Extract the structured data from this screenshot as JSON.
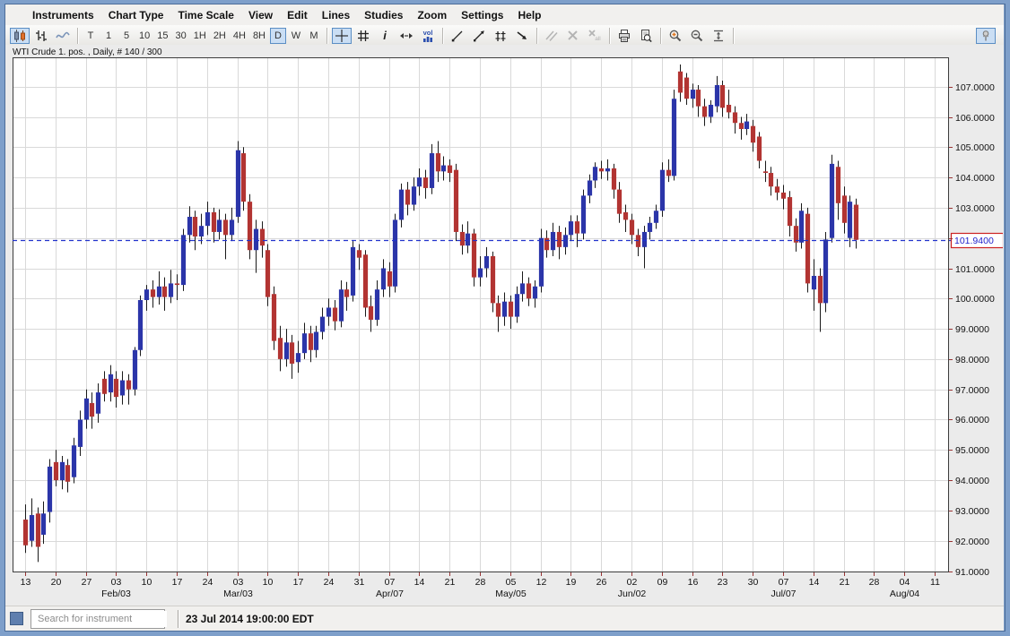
{
  "menubar": {
    "items": [
      "Instruments",
      "Chart Type",
      "Time Scale",
      "View",
      "Edit",
      "Lines",
      "Studies",
      "Zoom",
      "Settings",
      "Help"
    ]
  },
  "toolbar": {
    "groups": [
      {
        "name": "chart-type",
        "buttons": [
          {
            "icon": "candlestick-chart-icon",
            "selected": true
          },
          {
            "icon": "ohlc-bars-icon"
          },
          {
            "icon": "line-chart-icon"
          }
        ]
      },
      {
        "name": "timescale",
        "buttons": [
          {
            "label": "T"
          },
          {
            "label": "1"
          },
          {
            "label": "5"
          },
          {
            "label": "10"
          },
          {
            "label": "15"
          },
          {
            "label": "30"
          },
          {
            "label": "1H"
          },
          {
            "label": "2H"
          },
          {
            "label": "4H"
          },
          {
            "label": "8H"
          },
          {
            "label": "D",
            "selected": true
          },
          {
            "label": "W"
          },
          {
            "label": "M"
          }
        ]
      },
      {
        "name": "cursor-tools",
        "buttons": [
          {
            "icon": "crosshair-icon",
            "selected": true
          },
          {
            "icon": "grid-icon"
          },
          {
            "icon": "info-icon"
          },
          {
            "icon": "expand-horizontal-icon"
          },
          {
            "icon": "volume-icon"
          }
        ]
      },
      {
        "name": "draw-tools",
        "buttons": [
          {
            "icon": "trendline-icon"
          },
          {
            "icon": "ray-icon"
          },
          {
            "icon": "channel-icon"
          },
          {
            "icon": "arrow-icon"
          }
        ]
      },
      {
        "name": "line-edit",
        "buttons": [
          {
            "icon": "parallel-lines-icon",
            "disabled": true
          },
          {
            "icon": "delete-icon",
            "disabled": true
          },
          {
            "icon": "delete-all-icon",
            "disabled": true
          }
        ]
      },
      {
        "name": "print",
        "buttons": [
          {
            "icon": "print-icon"
          },
          {
            "icon": "print-preview-icon"
          }
        ]
      },
      {
        "name": "zoom",
        "buttons": [
          {
            "icon": "zoom-in-icon"
          },
          {
            "icon": "zoom-out-icon"
          },
          {
            "icon": "fit-vertical-icon"
          }
        ]
      }
    ],
    "pin": {
      "icon": "pin-icon"
    },
    "delete_all_sub": "all"
  },
  "chart": {
    "title": "WTI Crude 1. pos. , Daily, # 140 / 300"
  },
  "statusbar": {
    "search_placeholder": "Search for instrument",
    "timestamp": "23 Jul 2014 19:00:00 EDT"
  },
  "chart_data": {
    "type": "candlestick",
    "instrument": "WTI Crude 1. pos.",
    "interval": "Daily",
    "bar_count_label": "# 140 / 300",
    "ylim": [
      91,
      107
    ],
    "y_tick_step": 1.0,
    "y_tick_decimals": 4,
    "grid": true,
    "last_price": 101.94,
    "last_price_label": "101.9400",
    "colors": {
      "up": "#2b35a9",
      "down": "#b23432",
      "wick": "#1a1a1a",
      "grid": "#d9d9d9",
      "last_price_line": "#2233cc",
      "label_border": "#cc2222",
      "label_text": "#2222cc",
      "tick": "#993333"
    },
    "x_labels": [
      {
        "d": "13"
      },
      {
        "d": "20"
      },
      {
        "d": "27"
      },
      {
        "d": "03",
        "m": "Feb/03"
      },
      {
        "d": "10"
      },
      {
        "d": "17"
      },
      {
        "d": "24"
      },
      {
        "d": "03",
        "m": "Mar/03"
      },
      {
        "d": "10"
      },
      {
        "d": "17"
      },
      {
        "d": "24"
      },
      {
        "d": "31"
      },
      {
        "d": "07",
        "m": "Apr/07"
      },
      {
        "d": "14"
      },
      {
        "d": "21"
      },
      {
        "d": "28"
      },
      {
        "d": "05",
        "m": "May/05"
      },
      {
        "d": "12"
      },
      {
        "d": "19"
      },
      {
        "d": "26"
      },
      {
        "d": "02",
        "m": "Jun/02"
      },
      {
        "d": "09"
      },
      {
        "d": "16"
      },
      {
        "d": "23"
      },
      {
        "d": "30"
      },
      {
        "d": "07",
        "m": "Jul/07"
      },
      {
        "d": "14"
      },
      {
        "d": "21"
      },
      {
        "d": "28"
      },
      {
        "d": "04",
        "m": "Aug/04"
      },
      {
        "d": "11"
      }
    ],
    "start_date": "13 Jan 2014",
    "end_date": "23 Jul 2014",
    "candles_ohlc": [
      [
        92.7,
        93.2,
        91.6,
        91.85
      ],
      [
        92.0,
        93.4,
        91.8,
        92.85
      ],
      [
        92.9,
        93.1,
        91.3,
        91.8
      ],
      [
        92.2,
        93.3,
        91.9,
        92.9
      ],
      [
        92.95,
        94.7,
        92.6,
        94.45
      ],
      [
        94.6,
        95.0,
        93.8,
        94.0
      ],
      [
        94.0,
        94.8,
        93.7,
        94.6
      ],
      [
        94.5,
        94.7,
        93.6,
        93.95
      ],
      [
        94.1,
        95.4,
        93.9,
        95.15
      ],
      [
        95.1,
        96.3,
        94.8,
        96.0
      ],
      [
        96.0,
        97.0,
        95.7,
        96.7
      ],
      [
        96.55,
        96.9,
        95.7,
        96.1
      ],
      [
        96.2,
        97.2,
        95.9,
        96.9
      ],
      [
        97.35,
        97.6,
        96.6,
        96.85
      ],
      [
        96.9,
        97.8,
        96.6,
        97.5
      ],
      [
        97.35,
        97.6,
        96.4,
        96.75
      ],
      [
        96.8,
        97.6,
        96.5,
        97.3
      ],
      [
        97.3,
        97.5,
        96.5,
        97.0
      ],
      [
        97.0,
        98.4,
        96.8,
        98.3
      ],
      [
        98.3,
        100.1,
        98.1,
        99.95
      ],
      [
        99.95,
        100.45,
        99.6,
        100.3
      ],
      [
        100.3,
        100.6,
        99.7,
        100.05
      ],
      [
        100.05,
        100.9,
        99.8,
        100.4
      ],
      [
        100.4,
        100.7,
        99.6,
        100.05
      ],
      [
        100.05,
        100.95,
        99.85,
        100.5
      ],
      [
        100.5,
        100.8,
        99.95,
        100.45
      ],
      [
        100.45,
        102.3,
        100.25,
        102.1
      ],
      [
        102.1,
        103.05,
        101.85,
        102.7
      ],
      [
        102.7,
        102.9,
        101.6,
        102.05
      ],
      [
        102.05,
        102.8,
        101.8,
        102.4
      ],
      [
        102.4,
        103.2,
        102.1,
        102.85
      ],
      [
        102.85,
        103.0,
        101.85,
        102.2
      ],
      [
        102.2,
        102.95,
        101.95,
        102.6
      ],
      [
        102.6,
        102.8,
        101.3,
        102.1
      ],
      [
        102.1,
        103.0,
        101.9,
        102.6
      ],
      [
        102.7,
        105.2,
        102.5,
        104.9
      ],
      [
        104.8,
        105.0,
        102.9,
        103.2
      ],
      [
        103.2,
        103.45,
        101.3,
        101.6
      ],
      [
        101.6,
        102.6,
        100.85,
        102.3
      ],
      [
        102.3,
        102.55,
        101.35,
        101.75
      ],
      [
        101.6,
        101.8,
        99.75,
        100.05
      ],
      [
        100.15,
        100.4,
        98.3,
        98.6
      ],
      [
        98.7,
        99.1,
        97.6,
        98.0
      ],
      [
        98.0,
        99.0,
        97.75,
        98.55
      ],
      [
        98.55,
        98.8,
        97.35,
        97.85
      ],
      [
        97.9,
        98.6,
        97.55,
        98.2
      ],
      [
        98.2,
        99.2,
        98.0,
        98.85
      ],
      [
        98.85,
        99.1,
        97.9,
        98.3
      ],
      [
        98.3,
        99.1,
        98.05,
        98.9
      ],
      [
        98.9,
        99.7,
        98.65,
        99.4
      ],
      [
        99.4,
        100.0,
        99.1,
        99.7
      ],
      [
        99.7,
        99.95,
        98.95,
        99.25
      ],
      [
        99.25,
        100.6,
        99.05,
        100.3
      ],
      [
        100.3,
        100.55,
        99.6,
        100.05
      ],
      [
        100.1,
        101.9,
        99.9,
        101.7
      ],
      [
        101.6,
        101.8,
        100.95,
        101.35
      ],
      [
        101.45,
        101.6,
        99.4,
        99.7
      ],
      [
        99.75,
        100.1,
        98.9,
        99.3
      ],
      [
        99.3,
        100.6,
        99.1,
        100.3
      ],
      [
        100.3,
        101.3,
        100.05,
        101.0
      ],
      [
        100.9,
        101.2,
        100.05,
        100.4
      ],
      [
        100.4,
        102.8,
        100.2,
        102.6
      ],
      [
        102.6,
        103.8,
        102.35,
        103.6
      ],
      [
        103.6,
        103.85,
        102.75,
        103.1
      ],
      [
        103.1,
        104.0,
        102.9,
        103.7
      ],
      [
        103.7,
        104.3,
        103.4,
        104.0
      ],
      [
        104.0,
        104.25,
        103.3,
        103.65
      ],
      [
        103.65,
        105.1,
        103.45,
        104.8
      ],
      [
        104.8,
        105.2,
        103.85,
        104.2
      ],
      [
        104.2,
        104.7,
        103.9,
        104.4
      ],
      [
        104.4,
        104.6,
        103.85,
        104.15
      ],
      [
        104.25,
        104.45,
        101.9,
        102.2
      ],
      [
        102.2,
        102.45,
        101.45,
        101.75
      ],
      [
        101.75,
        102.55,
        101.5,
        102.15
      ],
      [
        102.15,
        102.3,
        100.4,
        100.7
      ],
      [
        100.7,
        101.4,
        100.4,
        101.0
      ],
      [
        101.0,
        101.7,
        100.7,
        101.4
      ],
      [
        101.4,
        101.55,
        99.55,
        99.85
      ],
      [
        99.85,
        100.1,
        98.9,
        99.4
      ],
      [
        99.4,
        100.2,
        99.1,
        99.9
      ],
      [
        99.9,
        100.1,
        99.0,
        99.4
      ],
      [
        99.4,
        100.4,
        99.2,
        100.15
      ],
      [
        100.15,
        100.9,
        99.9,
        100.5
      ],
      [
        100.5,
        100.7,
        99.75,
        100.0
      ],
      [
        100.0,
        100.6,
        99.7,
        100.4
      ],
      [
        100.4,
        102.3,
        100.2,
        102.0
      ],
      [
        102.0,
        102.25,
        101.35,
        101.6
      ],
      [
        101.6,
        102.5,
        101.4,
        102.2
      ],
      [
        102.2,
        102.4,
        101.3,
        101.7
      ],
      [
        101.7,
        102.35,
        101.45,
        102.1
      ],
      [
        102.1,
        102.75,
        101.9,
        102.55
      ],
      [
        102.55,
        102.75,
        101.7,
        102.15
      ],
      [
        102.15,
        103.6,
        101.95,
        103.4
      ],
      [
        103.4,
        104.1,
        103.15,
        103.9
      ],
      [
        103.9,
        104.5,
        103.65,
        104.35
      ],
      [
        104.3,
        104.55,
        103.95,
        104.2
      ],
      [
        104.2,
        104.6,
        103.9,
        104.3
      ],
      [
        104.3,
        104.45,
        103.3,
        103.6
      ],
      [
        103.6,
        103.85,
        102.5,
        102.8
      ],
      [
        102.85,
        103.1,
        102.2,
        102.6
      ],
      [
        102.6,
        102.8,
        101.8,
        102.1
      ],
      [
        102.1,
        102.3,
        101.4,
        101.7
      ],
      [
        101.7,
        102.4,
        101.0,
        102.2
      ],
      [
        102.2,
        102.7,
        101.95,
        102.5
      ],
      [
        102.5,
        103.1,
        102.3,
        102.9
      ],
      [
        102.9,
        104.5,
        102.7,
        104.25
      ],
      [
        104.25,
        104.6,
        103.85,
        104.05
      ],
      [
        104.05,
        106.9,
        103.9,
        106.6
      ],
      [
        107.5,
        107.73,
        106.5,
        106.8
      ],
      [
        107.3,
        107.45,
        106.4,
        106.6
      ],
      [
        106.6,
        107.1,
        106.3,
        106.9
      ],
      [
        106.9,
        107.05,
        106.0,
        106.35
      ],
      [
        106.35,
        106.6,
        105.7,
        106.0
      ],
      [
        106.0,
        106.55,
        105.8,
        106.4
      ],
      [
        106.35,
        107.35,
        106.15,
        107.05
      ],
      [
        107.05,
        107.2,
        106.0,
        106.3
      ],
      [
        106.4,
        106.9,
        105.95,
        106.15
      ],
      [
        106.15,
        106.35,
        105.45,
        105.8
      ],
      [
        105.8,
        106.0,
        105.25,
        105.6
      ],
      [
        105.6,
        106.1,
        105.4,
        105.85
      ],
      [
        105.7,
        105.9,
        104.85,
        105.15
      ],
      [
        105.35,
        105.5,
        104.3,
        104.55
      ],
      [
        104.2,
        104.55,
        103.85,
        104.15
      ],
      [
        104.15,
        104.35,
        103.4,
        103.7
      ],
      [
        103.7,
        103.95,
        103.25,
        103.5
      ],
      [
        103.5,
        103.75,
        102.95,
        103.3
      ],
      [
        103.35,
        103.55,
        102.05,
        102.4
      ],
      [
        102.4,
        102.65,
        101.55,
        101.85
      ],
      [
        101.85,
        103.15,
        101.65,
        102.9
      ],
      [
        102.8,
        103.0,
        100.2,
        100.5
      ],
      [
        100.3,
        101.3,
        99.6,
        100.75
      ],
      [
        100.75,
        101.0,
        98.9,
        99.85
      ],
      [
        99.85,
        102.2,
        99.55,
        101.95
      ],
      [
        102.0,
        104.75,
        101.85,
        104.45
      ],
      [
        104.35,
        104.55,
        102.6,
        103.15
      ],
      [
        103.4,
        103.7,
        102.15,
        102.5
      ],
      [
        102.0,
        103.4,
        101.7,
        103.2
      ],
      [
        103.1,
        103.3,
        101.65,
        101.94
      ]
    ]
  }
}
